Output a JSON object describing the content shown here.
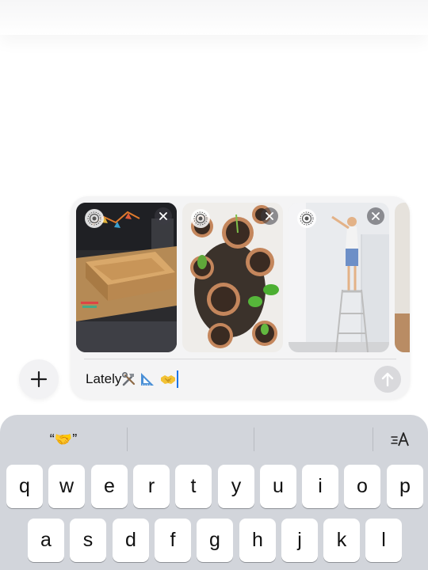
{
  "compose": {
    "message_text": "Lately",
    "message_emojis": [
      "hammer-and-wrench",
      "triangular-ruler",
      "handshake"
    ]
  },
  "attachments": [
    {
      "description_icon": "live-photo-icon",
      "remove_icon": "close-icon"
    },
    {
      "description_icon": "live-photo-icon",
      "remove_icon": "close-icon"
    },
    {
      "description_icon": "live-photo-icon",
      "remove_icon": "close-icon"
    }
  ],
  "suggestions": {
    "first": "“🤝”",
    "second": "",
    "third": ""
  },
  "keyboard": {
    "row1": [
      "q",
      "w",
      "e",
      "r",
      "t",
      "y",
      "u",
      "i",
      "o",
      "p"
    ],
    "row2": [
      "a",
      "s",
      "d",
      "f",
      "g",
      "h",
      "j",
      "k",
      "l"
    ]
  },
  "colors": {
    "caret": "#1a73e8",
    "keyboard_bg": "#d2d5db",
    "compose_bg": "#f4f4f5"
  }
}
